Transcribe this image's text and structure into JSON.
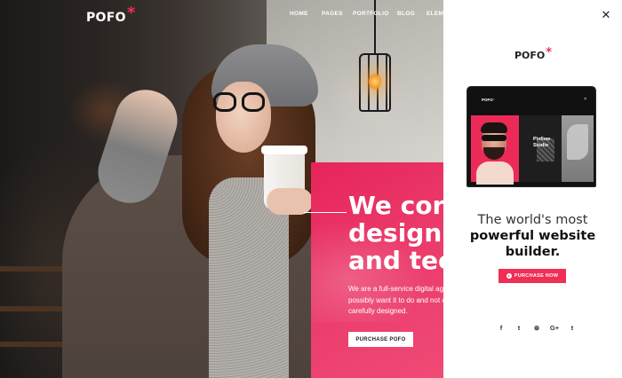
{
  "header": {
    "logo_text": "POFO",
    "logo_mark": "*",
    "nav": [
      {
        "label": "HOME"
      },
      {
        "label": "PAGES"
      },
      {
        "label": "PORTFOLIO"
      },
      {
        "label": "BLOG"
      },
      {
        "label": "ELEME"
      }
    ]
  },
  "hero": {
    "headline_lines": [
      "We cor",
      "design,",
      "and tec"
    ],
    "body_lines": [
      "We are a full-service digital age",
      "possibly want it to do and not c",
      "carefully designed."
    ],
    "button_label": "PURCHASE POFO"
  },
  "side_panel": {
    "close_icon": "close-icon",
    "logo_text": "POFO",
    "logo_mark": "*",
    "laptop_screen": {
      "logo_text": "POFO",
      "logo_mark": "*",
      "close_glyph": "×",
      "studio_text": "Pixflow Studio"
    },
    "tagline_light": "The world's most",
    "tagline_bold": "powerful website builder.",
    "button_label": "PURCHASE NOW",
    "social": [
      {
        "name": "facebook-icon",
        "glyph": "f"
      },
      {
        "name": "twitter-icon",
        "glyph": "t"
      },
      {
        "name": "dribbble-icon",
        "glyph": "⊛"
      },
      {
        "name": "google-plus-icon",
        "glyph": "G+"
      },
      {
        "name": "tumblr-icon",
        "glyph": "t"
      }
    ]
  },
  "colors": {
    "accent": "#ef2f55",
    "pink_panel": "#e8245a"
  }
}
